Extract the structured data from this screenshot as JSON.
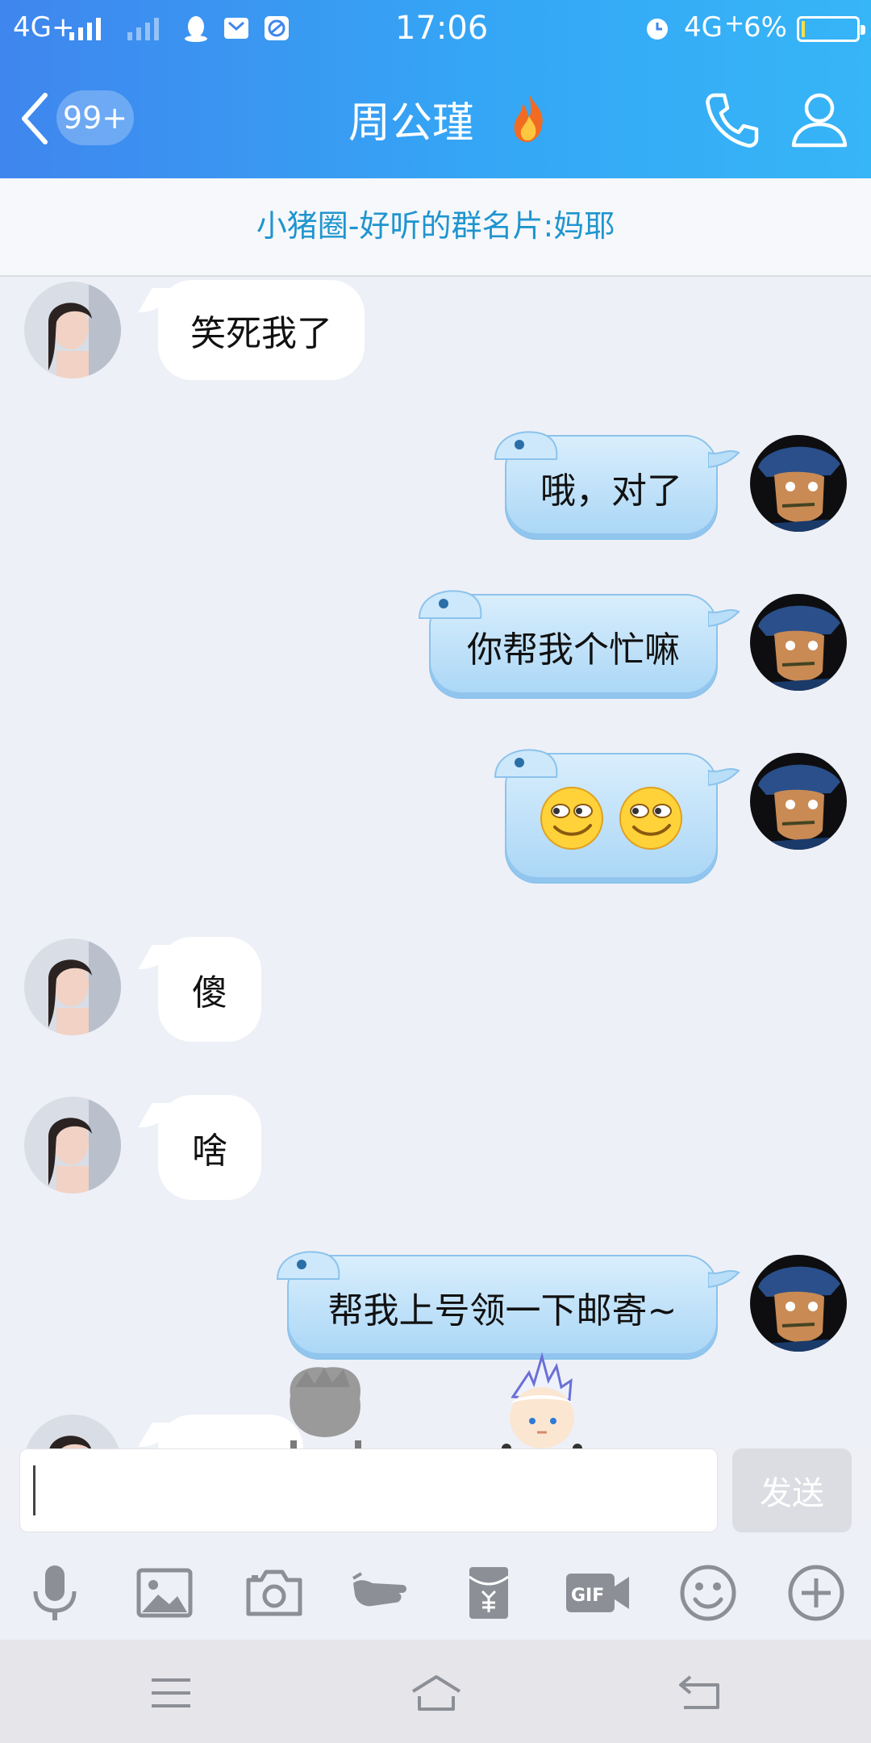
{
  "status_bar": {
    "network": "4G+",
    "time": "17:06",
    "network2": "4G",
    "battery": "6%",
    "battery_level": 0.06
  },
  "header": {
    "unread_count": "99+",
    "title": "周公瑾"
  },
  "banner": {
    "text": "小猪圈-好听的群名片:妈耶"
  },
  "messages": [
    {
      "side": "in",
      "text": "笑死我了"
    },
    {
      "side": "out",
      "text": "哦，对了"
    },
    {
      "side": "out",
      "text": "你帮我个忙嘛"
    },
    {
      "side": "out",
      "emoji": [
        "smirk-emoji",
        "smirk-emoji"
      ]
    },
    {
      "side": "in",
      "text": "傻"
    },
    {
      "side": "in",
      "text": "啥"
    },
    {
      "side": "out",
      "text": "帮我上号领一下邮寄~"
    }
  ],
  "input": {
    "value": "",
    "send_label": "发送"
  },
  "toolbar": {
    "items": [
      "microphone-icon",
      "image-icon",
      "camera-icon",
      "poke-icon",
      "red-packet-icon",
      "gif-icon",
      "emoji-icon",
      "plus-icon"
    ]
  },
  "nav": {
    "items": [
      "menu-icon",
      "home-icon",
      "back-icon"
    ]
  }
}
